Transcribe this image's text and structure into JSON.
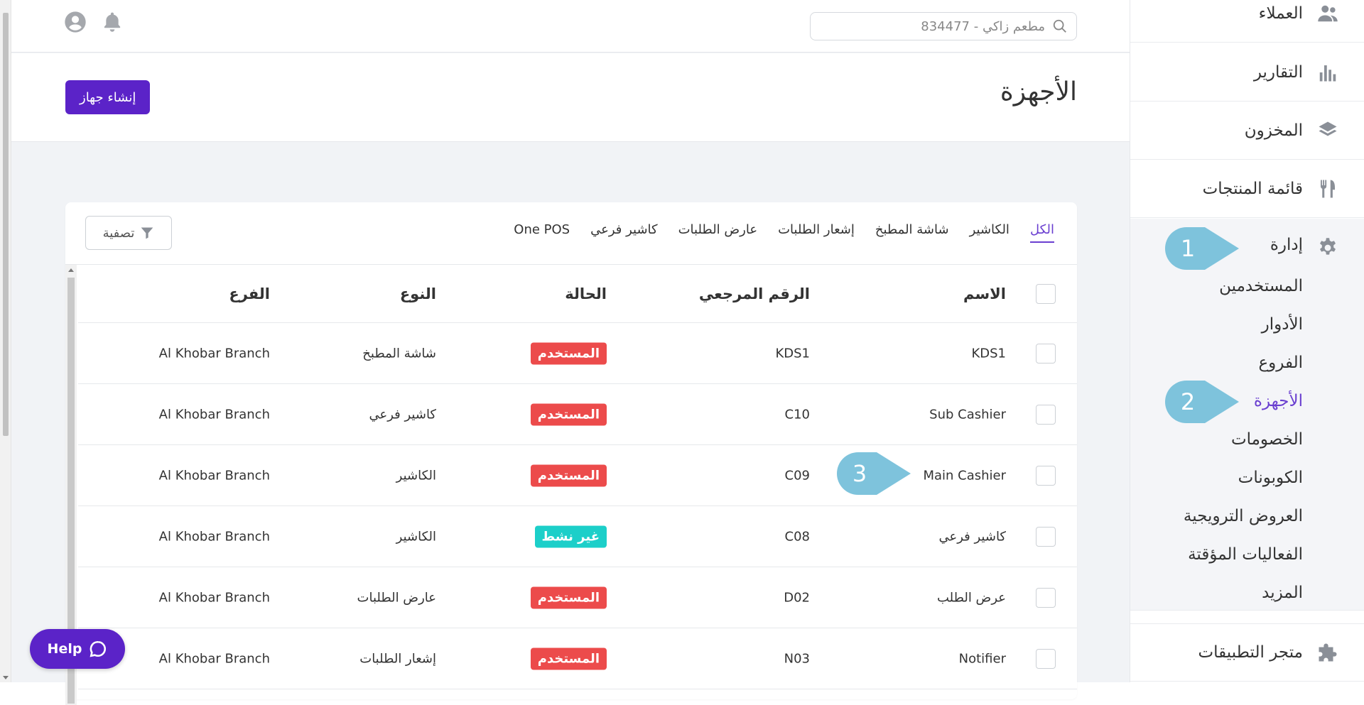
{
  "topbar": {
    "search_placeholder": "مطعم زاكي - 834477"
  },
  "page": {
    "title": "الأجهزة",
    "create_button": "إنشاء جهاز"
  },
  "tabs": [
    {
      "label": "الكل",
      "active": true
    },
    {
      "label": "الكاشير"
    },
    {
      "label": "شاشة المطبخ"
    },
    {
      "label": "إشعار الطلبات"
    },
    {
      "label": "عارض الطلبات"
    },
    {
      "label": "كاشير فرعي"
    },
    {
      "label": "One POS"
    }
  ],
  "filter_label": "تصفية",
  "table": {
    "columns": {
      "name": "الاسم",
      "ref": "الرقم المرجعي",
      "status": "الحالة",
      "type": "النوع",
      "branch": "الفرع"
    },
    "rows": [
      {
        "name": "KDS1",
        "ref": "KDS1",
        "status": "المستخدم",
        "type": "شاشة المطبخ",
        "branch": "Al Khobar Branch"
      },
      {
        "name": "Sub Cashier",
        "ref": "C10",
        "status": "المستخدم",
        "type": "كاشير فرعي",
        "branch": "Al Khobar Branch"
      },
      {
        "name": "Main Cashier",
        "ref": "C09",
        "status": "المستخدم",
        "type": "الكاشير",
        "branch": "Al Khobar Branch"
      },
      {
        "name": "كاشير فرعي",
        "ref": "C08",
        "status": "غير نشط",
        "type": "الكاشير",
        "branch": "Al Khobar Branch"
      },
      {
        "name": "عرض الطلب",
        "ref": "D02",
        "status": "المستخدم",
        "type": "عارض الطلبات",
        "branch": "Al Khobar Branch"
      },
      {
        "name": "Notifier",
        "ref": "N03",
        "status": "المستخدم",
        "type": "إشعار الطلبات",
        "branch": "Al Khobar Branch"
      }
    ]
  },
  "sidebar": {
    "items": [
      {
        "label": "العملاء",
        "icon": "customers-icon"
      },
      {
        "label": "التقارير",
        "icon": "reports-icon"
      },
      {
        "label": "المخزون",
        "icon": "inventory-icon"
      },
      {
        "label": "قائمة المنتجات",
        "icon": "menu-icon"
      }
    ],
    "admin": {
      "label": "إدارة",
      "icon": "gear-icon",
      "subitems": [
        {
          "label": "المستخدمين"
        },
        {
          "label": "الأدوار"
        },
        {
          "label": "الفروع"
        },
        {
          "label": "الأجهزة",
          "active": true
        },
        {
          "label": "الخصومات"
        },
        {
          "label": "الكوبونات"
        },
        {
          "label": "العروض الترويجية"
        },
        {
          "label": "الفعاليات المؤقتة"
        },
        {
          "label": "المزيد"
        }
      ]
    },
    "appstore": {
      "label": "متجر التطبيقات",
      "icon": "puzzle-icon"
    }
  },
  "callouts": {
    "one": "1",
    "two": "2",
    "three": "3"
  },
  "help_label": "Help",
  "colors": {
    "accent": "#5b23c8",
    "status_used": "#ec4b4b",
    "status_inactive": "#1ccfc9"
  }
}
